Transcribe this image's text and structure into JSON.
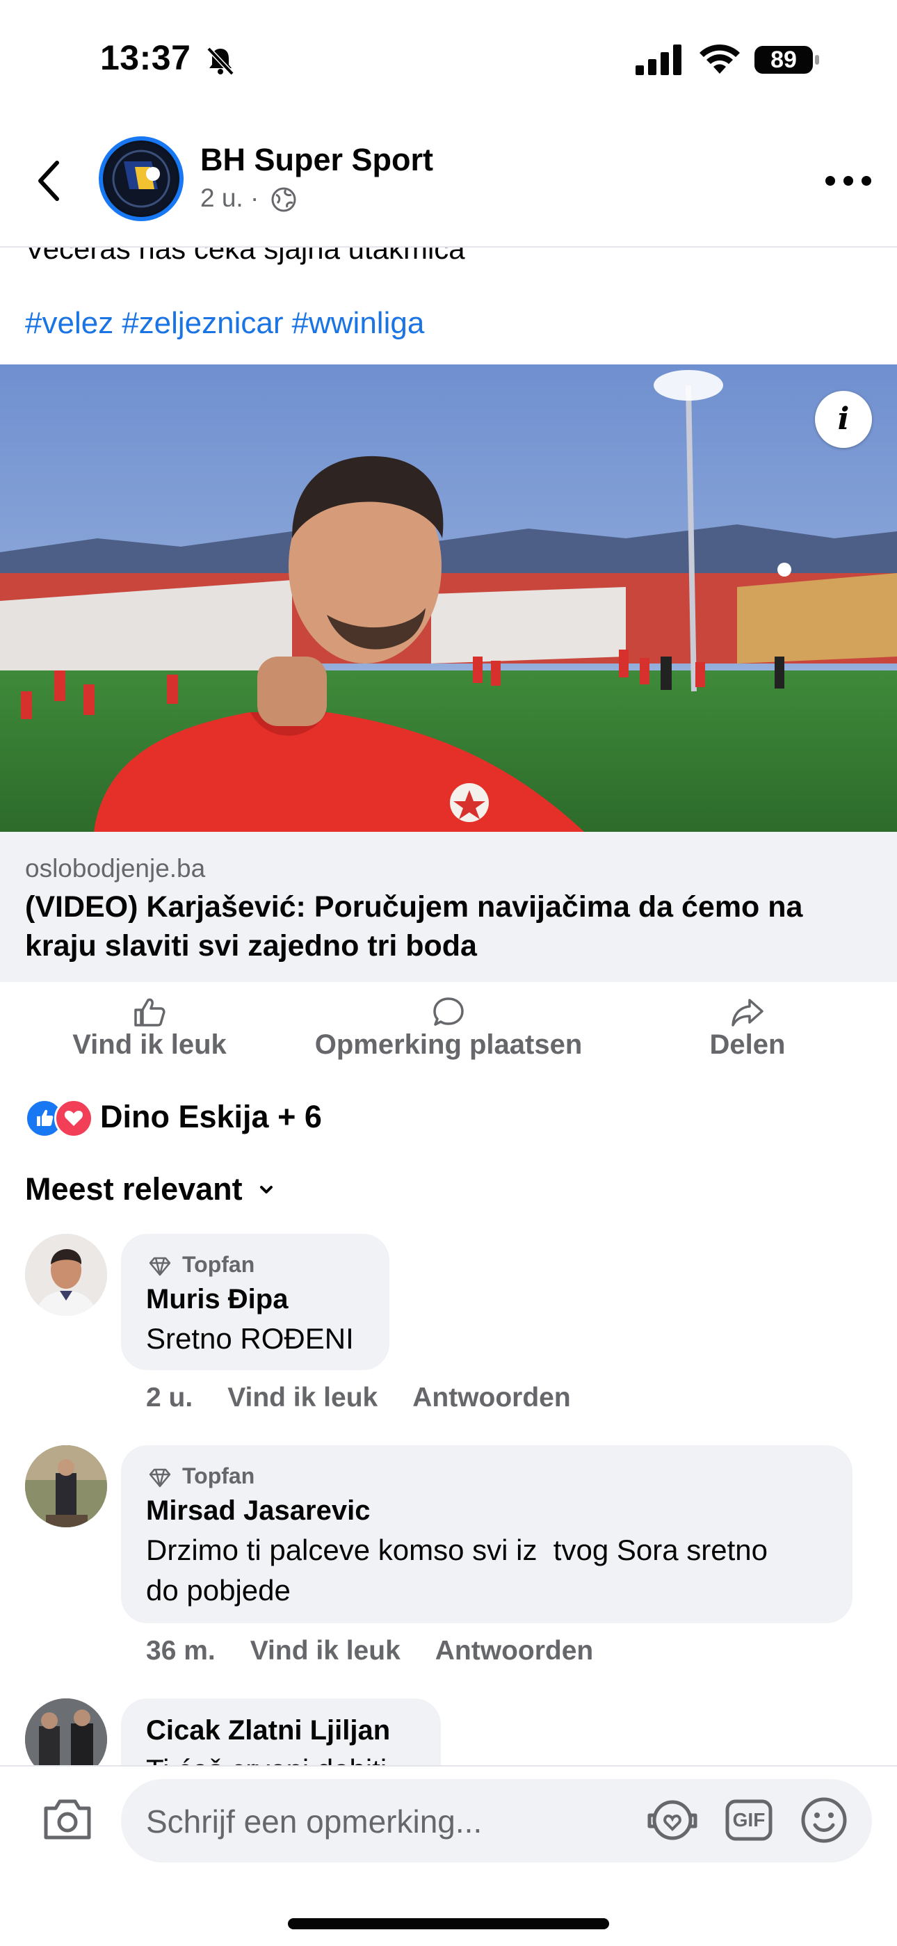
{
  "status_bar": {
    "time": "13:37",
    "battery": "89"
  },
  "header": {
    "page_name": "BH Super Sport",
    "time_ago": "2 u. ·"
  },
  "post": {
    "text": "Večeras nas čeka sjajna utakmica",
    "hashtags": [
      "#velez",
      "#zeljeznicar",
      "#wwinliga"
    ],
    "info_label": "i"
  },
  "link": {
    "domain": "oslobodjenje.ba",
    "title": "(VIDEO) Karjašević: Poručujem navijačima da ćemo na kraju slaviti svi zajedno tri boda"
  },
  "actions": {
    "like": "Vind ik leuk",
    "comment": "Opmerking plaatsen",
    "share": "Delen"
  },
  "reactions": {
    "names": "Dino Eskija + 6"
  },
  "sort": {
    "label": "Meest relevant"
  },
  "comments": [
    {
      "badge": "Topfan",
      "name": "Muris Đipa",
      "text": "Sretno ROĐENI",
      "time": "2 u.",
      "like": "Vind ik leuk",
      "reply": "Antwoorden"
    },
    {
      "badge": "Topfan",
      "name": "Mirsad Jasarevic",
      "text_line1": "Drzimo ti palceve komso svi iz  tvog Sora sretno",
      "text_line2": "do pobjede",
      "time": "36 m.",
      "like": "Vind ik leuk",
      "reply": "Antwoorden"
    },
    {
      "name": "Cicak Zlatni Ljiljan",
      "text": "Ti ćeš crveni dobiti"
    }
  ],
  "composer": {
    "placeholder": "Schrijf een opmerking...",
    "gif": "GIF"
  },
  "colors": {
    "accent": "#1877f2",
    "link": "#1b74e4",
    "love": "#f33e58",
    "muted": "#65676b",
    "bubble": "#f0f2f5"
  }
}
